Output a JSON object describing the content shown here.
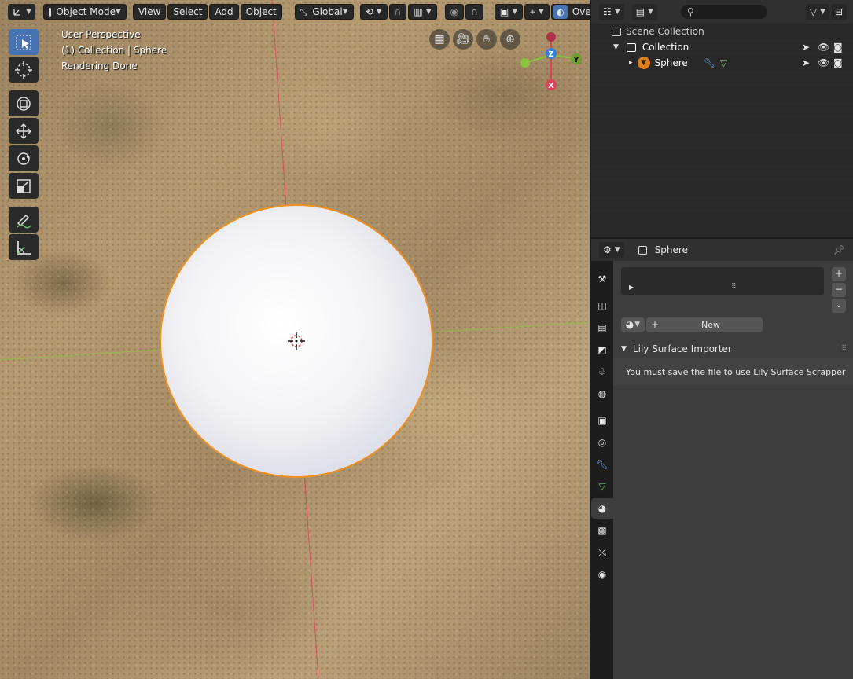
{
  "header": {
    "mode_label": "Object Mode",
    "menus": [
      "View",
      "Select",
      "Add",
      "Object"
    ],
    "orientation_label": "Global",
    "overlays_label": "Overlays"
  },
  "viewport": {
    "perspective": "User Perspective",
    "collection_info": "(1) Collection | Sphere",
    "status": "Rendering Done"
  },
  "gizmo": {
    "z": "Z",
    "y": "Y",
    "x": "X"
  },
  "colors": {
    "accent": "#4772b3",
    "selection_outline": "#f0901e",
    "x_axis": "#e0405a",
    "y_axis": "#8ac43f",
    "z_axis": "#2f7fe0"
  },
  "outliner": {
    "search_placeholder": "",
    "scene_collection": "Scene Collection",
    "collection": "Collection",
    "object": "Sphere"
  },
  "properties": {
    "object_name": "Sphere",
    "new_button": "New",
    "panel_title": "Lily Surface Importer",
    "message": "You must save the file to use Lily Surface Scrapper"
  }
}
